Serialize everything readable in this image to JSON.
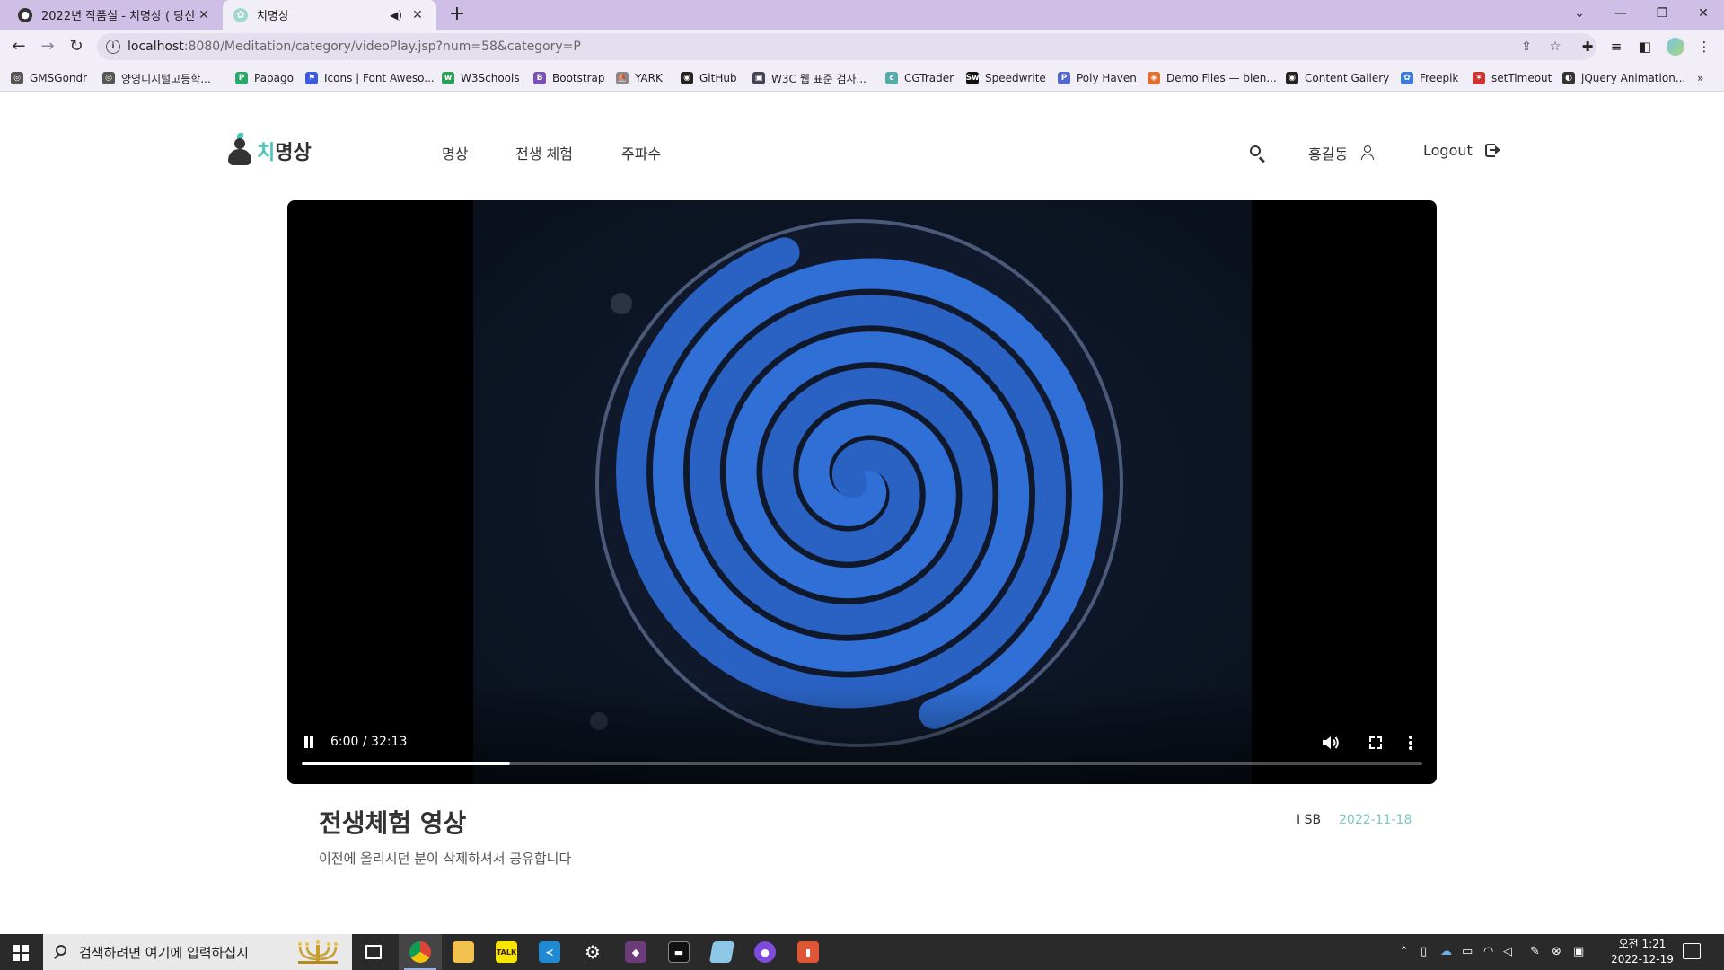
{
  "browser": {
    "tabs": [
      {
        "title": "2022년 작품실 - 치명상 ( 당신을",
        "active": false
      },
      {
        "title": "치명상",
        "active": true
      }
    ],
    "url_host": "localhost",
    "url_rest": ":8080/Meditation/category/videoPlay.jsp?num=58&category=P",
    "bookmarks": [
      "GMSGondr",
      "양영디지털고등학...",
      "Papago",
      "Icons | Font Aweso...",
      "W3Schools",
      "Bootstrap",
      "YARK",
      "GitHub",
      "W3C 웹 표준 검사...",
      "CGTrader",
      "Speedwrite",
      "Poly Haven",
      "Demo Files — blen...",
      "Content Gallery",
      "Freepik",
      "setTimeout",
      "jQuery Animation..."
    ],
    "bookmarks_more": "»"
  },
  "site": {
    "logo_accent": "치",
    "logo_rest": "명상",
    "nav": [
      "명상",
      "전생 체험",
      "주파수"
    ],
    "user_name": "홍길동",
    "logout_label": "Logout"
  },
  "video": {
    "current_time": "6:00",
    "duration": "32:13",
    "time_display": "6:00 / 32:13",
    "progress_fraction": 0.186,
    "state": "playing"
  },
  "post": {
    "title": "전생체험 영상",
    "description": "이전에 올리시던 분이 삭제하셔서 공유합니다",
    "author": "I SB",
    "date": "2022-11-18"
  },
  "taskbar": {
    "search_placeholder": "검색하려면 여기에 입력하십시",
    "clock_time": "오전 1:21",
    "clock_date": "2022-12-19"
  },
  "colors": {
    "accent": "#4ec3b8",
    "date": "#7cc8c5",
    "tabbar": "#cfbfe6",
    "spiral_blue": "#2f6fd6"
  }
}
